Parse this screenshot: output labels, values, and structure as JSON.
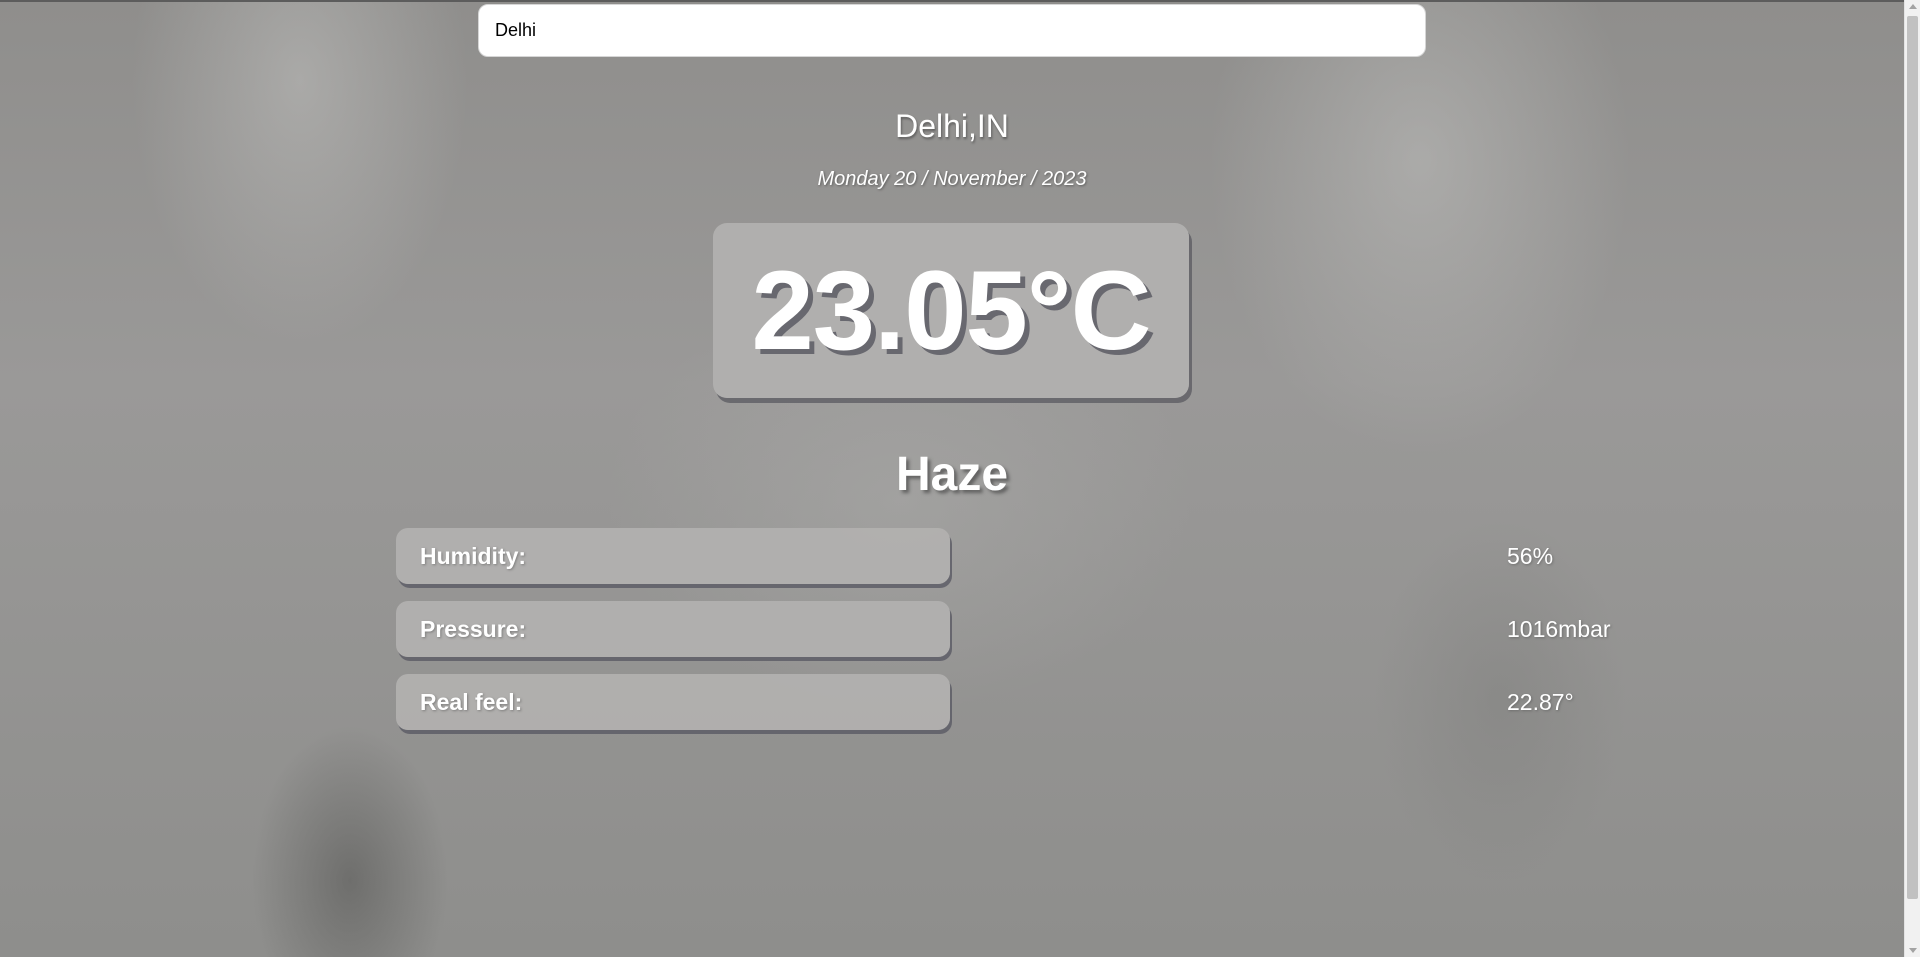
{
  "search": {
    "value": "Delhi",
    "placeholder": ""
  },
  "location": {
    "city_label": "Delhi,IN",
    "date_label": "Monday 20 / November / 2023"
  },
  "weather": {
    "temperature": "23.05°C",
    "condition": "Haze"
  },
  "stats": [
    {
      "label": "Humidity:",
      "value": "56%"
    },
    {
      "label": "Pressure:",
      "value": "1016mbar"
    },
    {
      "label": "Real feel:",
      "value": "22.87°"
    }
  ],
  "colors": {
    "card_background": "#b2b1b0",
    "card_shadow": "#5a5a60",
    "text": "#ffffff"
  }
}
